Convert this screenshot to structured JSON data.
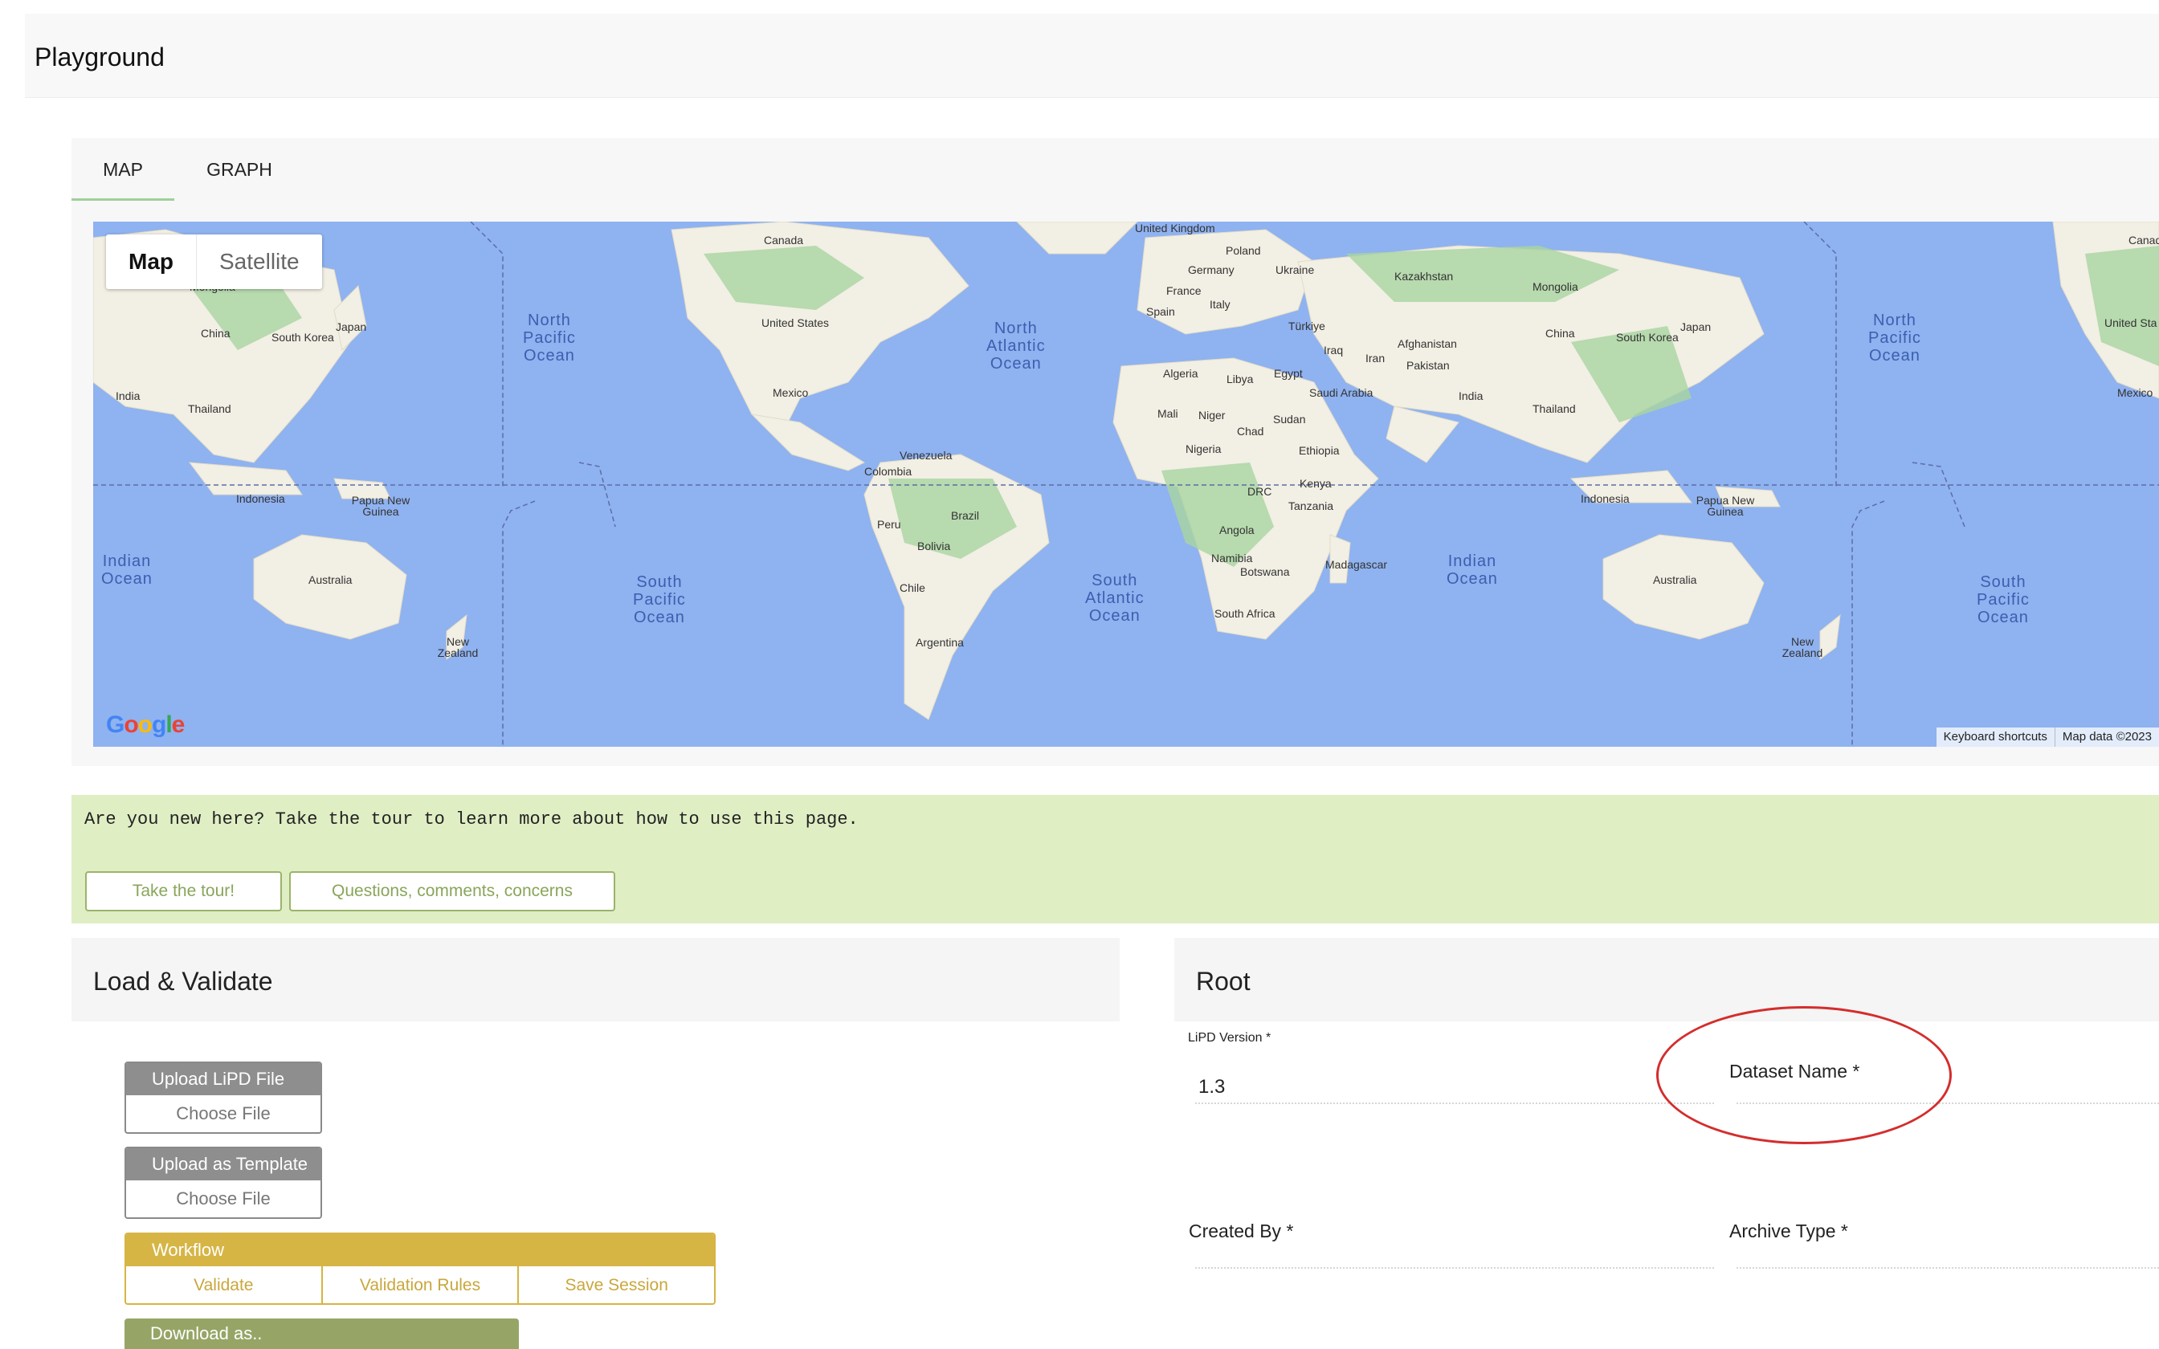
{
  "header": {
    "title": "Playground"
  },
  "tabs": [
    {
      "label": "MAP"
    },
    {
      "label": "GRAPH"
    }
  ],
  "map": {
    "type_control": {
      "map": "Map",
      "satellite": "Satellite"
    },
    "logo": "Google",
    "attribution": {
      "shortcuts": "Keyboard shortcuts",
      "data": "Map data ©2023"
    },
    "labels": [
      "Canada",
      "United States",
      "Mexico",
      "Venezuela",
      "Colombia",
      "Brazil",
      "Peru",
      "Bolivia",
      "Chile",
      "Argentina",
      "United Kingdom",
      "Poland",
      "Germany",
      "Ukraine",
      "France",
      "Italy",
      "Spain",
      "Türkiye",
      "Kazakhstan",
      "Mongolia",
      "China",
      "South Korea",
      "Japan",
      "Iraq",
      "Iran",
      "Afghanistan",
      "Pakistan",
      "India",
      "Thailand",
      "Indonesia",
      "Papua New Guinea",
      "Australia",
      "New Zealand",
      "Algeria",
      "Libya",
      "Egypt",
      "Saudi Arabia",
      "Mali",
      "Niger",
      "Chad",
      "Sudan",
      "Ethiopia",
      "Nigeria",
      "Kenya",
      "DRC",
      "Tanzania",
      "Angola",
      "Namibia",
      "Botswana",
      "Madagascar",
      "South Africa",
      "Mongolia",
      "China",
      "South Korea",
      "Japan",
      "India",
      "Thailand",
      "Indonesia",
      "Papua New Guinea",
      "Australia",
      "New Zealand",
      "Canada",
      "United Sta",
      "Mexico"
    ],
    "oceans": [
      "North\nPacific\nOcean",
      "North\nAtlantic\nOcean",
      "Indian\nOcean",
      "South\nPacific\nOcean",
      "South\nAtlantic\nOcean",
      "Indian\nOcean",
      "North\nPacific\nOcean",
      "South\nPacific\nOcean"
    ],
    "colors": {
      "water": "#8fb2f0",
      "land": "#f2efe4",
      "vegetation": "#a7d4a0"
    }
  },
  "banner": {
    "message": "Are you new here? Take the tour to learn more about how to use this page.",
    "tour_button": "Take the tour!",
    "questions_button": "Questions, comments, concerns"
  },
  "load_validate": {
    "title": "Load & Validate",
    "upload_lipd": {
      "label": "Upload LiPD File",
      "choose": "Choose File"
    },
    "upload_template": {
      "label": "Upload as Template",
      "choose": "Choose File"
    },
    "workflow": {
      "label": "Workflow",
      "validate": "Validate",
      "rules": "Validation Rules",
      "save": "Save Session"
    },
    "download": "Download as.."
  },
  "root": {
    "title": "Root",
    "lipd_version": {
      "label": "LiPD Version *",
      "value": "1.3"
    },
    "dataset_name": {
      "label": "Dataset Name *",
      "value": ""
    },
    "created_by": {
      "label": "Created By *",
      "value": ""
    },
    "archive_type": {
      "label": "Archive Type *",
      "value": ""
    }
  }
}
